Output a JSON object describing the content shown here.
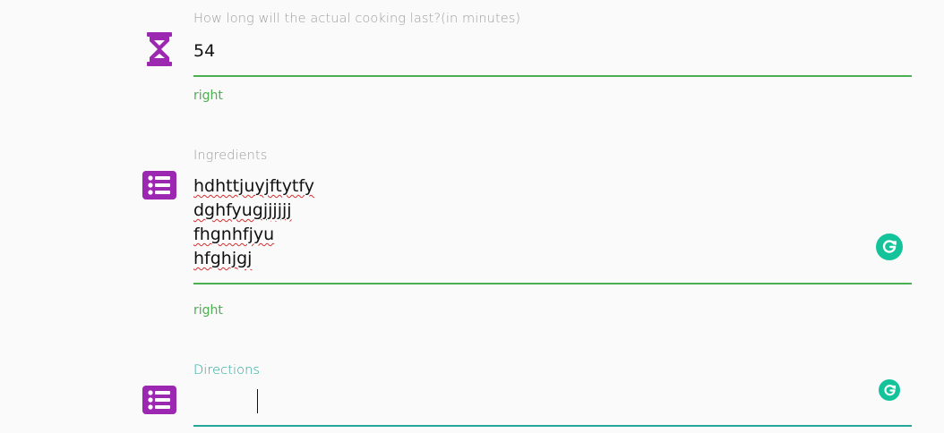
{
  "cooking_time": {
    "label": "How long will the actual cooking last?(in minutes)",
    "value": "54",
    "helper": "right",
    "icon": "hourglass-icon"
  },
  "ingredients": {
    "label": "Ingredients",
    "lines": [
      "hdhttjuyjftytfy",
      "dghfyugjjjjjj",
      "fhgnhfjyu",
      "hfghjgj"
    ],
    "helper": "right",
    "icon": "list-icon"
  },
  "directions": {
    "label": "Directions",
    "value": "",
    "icon": "list-icon"
  },
  "colors": {
    "accent_purple": "#9c27b0",
    "valid_green": "#4caf50",
    "focus_teal": "#26a69a",
    "grammarly_green": "#15c39a"
  }
}
